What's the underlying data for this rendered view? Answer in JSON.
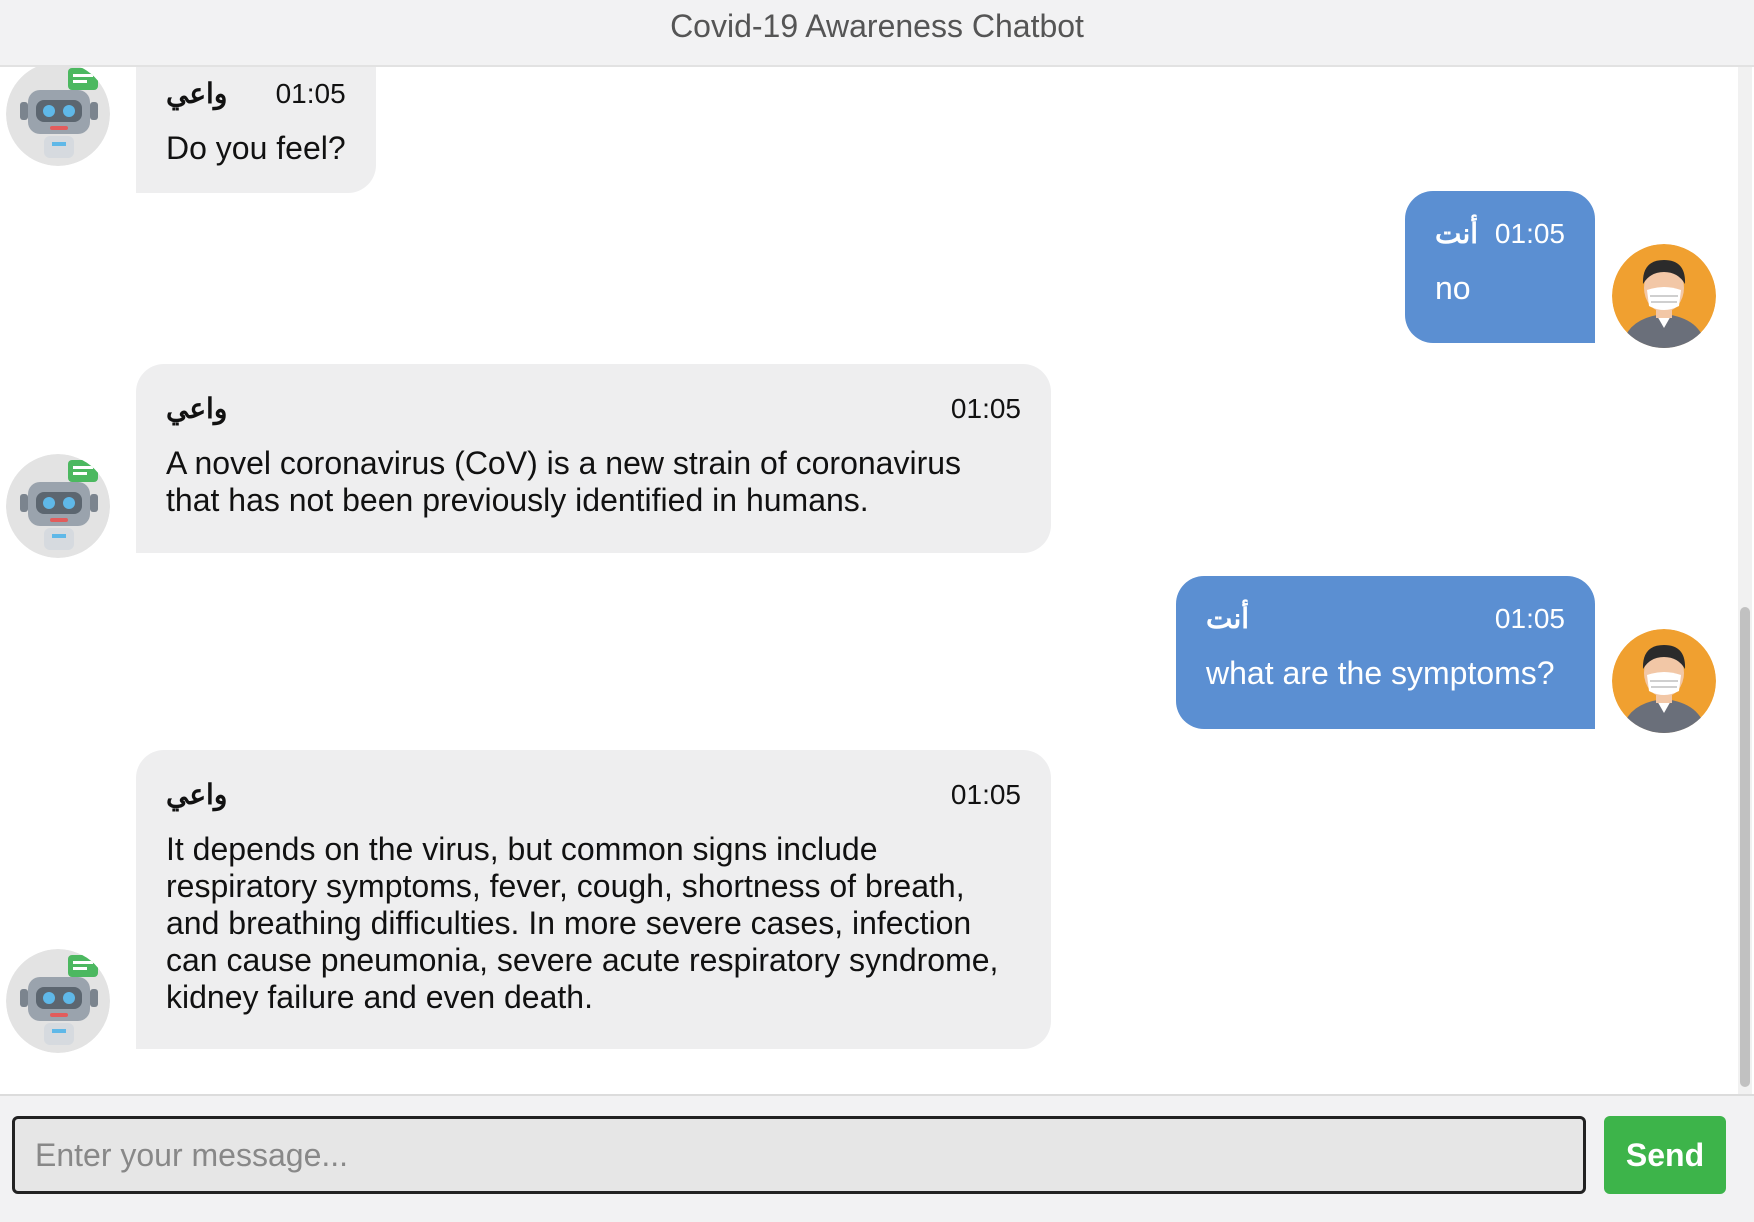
{
  "header": {
    "title": "Covid-19 Awareness Chatbot"
  },
  "messages": [
    {
      "role": "bot",
      "sender": "واعي",
      "time": "01:05",
      "text": "Do you feel?"
    },
    {
      "role": "user",
      "sender": "أنت",
      "time": "01:05",
      "text": "no"
    },
    {
      "role": "bot",
      "sender": "واعي",
      "time": "01:05",
      "text": "A novel coronavirus (CoV) is a new strain of coronavirus that has not been previously identified in humans."
    },
    {
      "role": "user",
      "sender": "أنت",
      "time": "01:05",
      "text": "what are the symptoms?"
    },
    {
      "role": "bot",
      "sender": "واعي",
      "time": "01:05",
      "text": "It depends on the virus, but common signs include respiratory symptoms, fever, cough, shortness of breath, and breathing difficulties. In more severe cases, infection can cause pneumonia, severe acute respiratory syndrome, kidney failure and even death."
    }
  ],
  "footer": {
    "placeholder": "Enter your message...",
    "send_label": "Send"
  },
  "colors": {
    "user_bubble": "#5b8fd2",
    "bot_bubble": "#eeeeef",
    "send_button": "#3db44a"
  },
  "icons": {
    "bot_avatar": "robot-icon",
    "user_avatar": "masked-person-icon"
  }
}
